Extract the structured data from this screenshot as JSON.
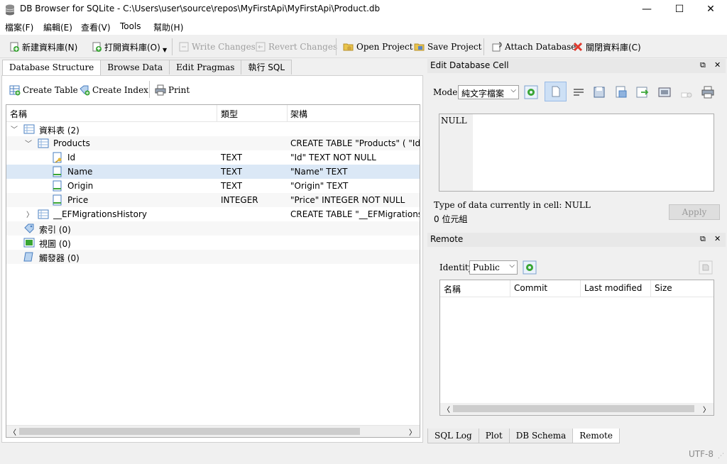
{
  "window": {
    "title": "DB Browser for SQLite - C:\\Users\\user\\source\\repos\\MyFirstApi\\MyFirstApi\\Product.db",
    "minimize": "—",
    "maximize": "☐",
    "close": "✕"
  },
  "menu": [
    "檔案(F)",
    "編輯(E)",
    "查看(V)",
    "Tools",
    "幫助(H)"
  ],
  "toolbar": {
    "new_db": "新建資料庫(N)",
    "open_db": "打開資料庫(O)",
    "write_changes": "Write Changes",
    "revert_changes": "Revert Changes",
    "open_project": "Open Project",
    "save_project": "Save Project",
    "attach_db": "Attach Database",
    "close_db": "關閉資料庫(C)"
  },
  "main_tabs": [
    "Database Structure",
    "Browse Data",
    "Edit Pragmas",
    "執行 SQL"
  ],
  "structure_toolbar": {
    "create_table": "Create Table",
    "create_index": "Create Index",
    "print": "Print"
  },
  "tree": {
    "headers": [
      "名稱",
      "類型",
      "架構"
    ],
    "rows": [
      {
        "name": "資料表 (2)",
        "type": "",
        "schema": ""
      },
      {
        "name": "Products",
        "type": "",
        "schema": "CREATE TABLE \"Products\" ( \"Id\" T"
      },
      {
        "name": "Id",
        "type": "TEXT",
        "schema": "\"Id\" TEXT NOT NULL"
      },
      {
        "name": "Name",
        "type": "TEXT",
        "schema": "\"Name\" TEXT"
      },
      {
        "name": "Origin",
        "type": "TEXT",
        "schema": "\"Origin\" TEXT"
      },
      {
        "name": "Price",
        "type": "INTEGER",
        "schema": "\"Price\" INTEGER NOT NULL"
      },
      {
        "name": "__EFMigrationsHistory",
        "type": "",
        "schema": "CREATE TABLE \"__EFMigrationsH"
      },
      {
        "name": "索引 (0)",
        "type": "",
        "schema": ""
      },
      {
        "name": "視圖 (0)",
        "type": "",
        "schema": ""
      },
      {
        "name": "觸發器 (0)",
        "type": "",
        "schema": ""
      }
    ]
  },
  "edit_cell": {
    "title": "Edit Database Cell",
    "mode_label": "Mode:",
    "mode_value": "純文字檔案",
    "cell_value": "NULL",
    "type_info": "Type of data currently in cell: NULL",
    "size_info": "0 位元組",
    "apply": "Apply"
  },
  "remote": {
    "title": "Remote",
    "identity_label": "Identity",
    "identity_value": "Public",
    "headers": [
      "名稱",
      "Commit",
      "Last modified",
      "Size"
    ]
  },
  "bottom_tabs": [
    "SQL Log",
    "Plot",
    "DB Schema",
    "Remote"
  ],
  "status": {
    "encoding": "UTF-8"
  },
  "icons": {
    "accent": "#3c7fc1",
    "table": "table-icon",
    "field": "field-icon",
    "key": "key-icon"
  }
}
